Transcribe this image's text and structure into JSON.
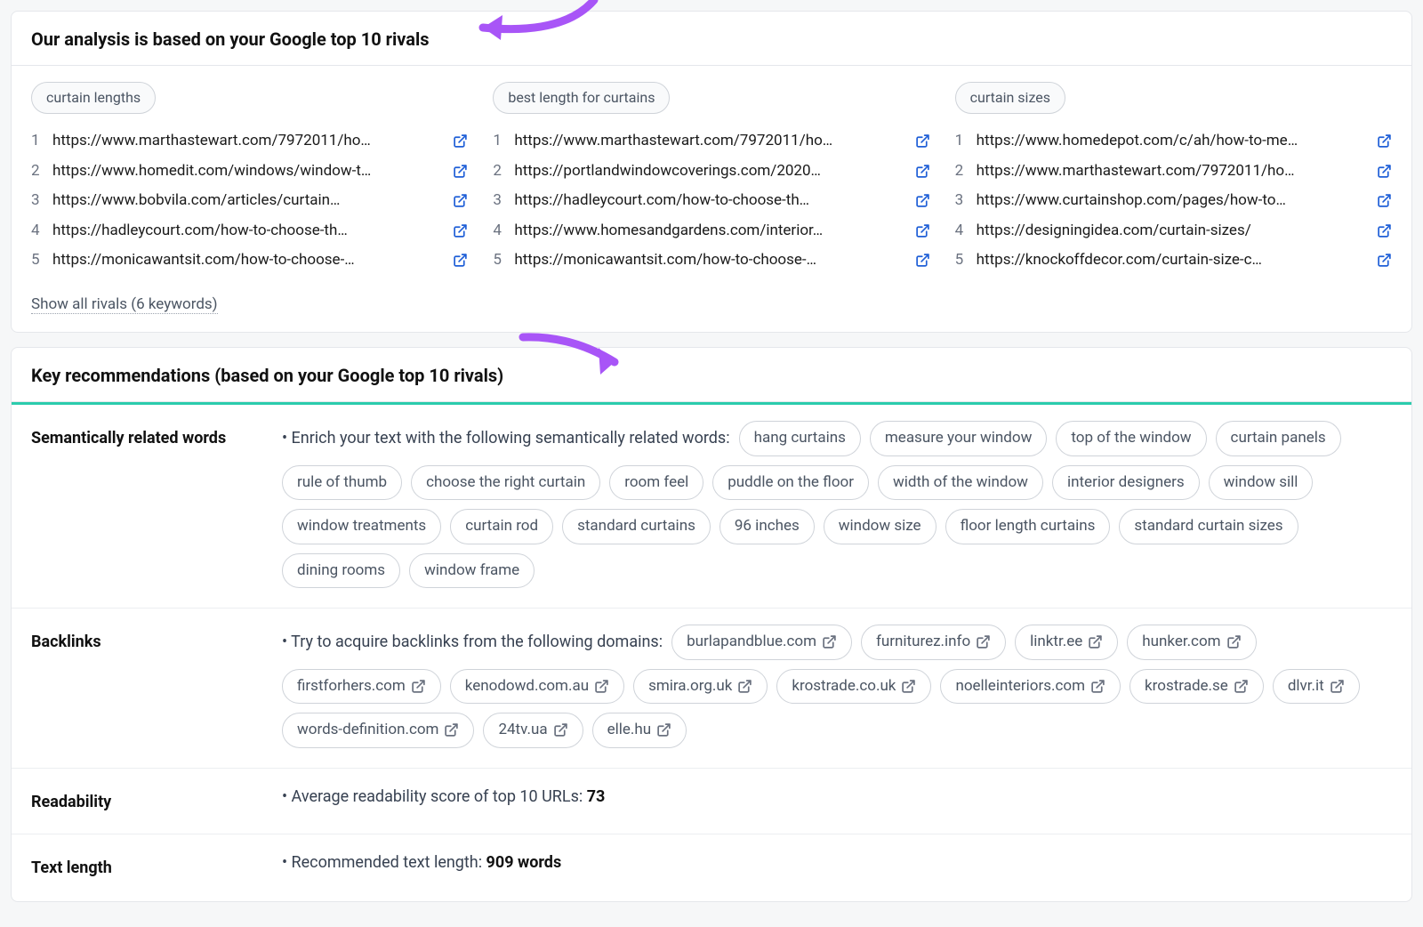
{
  "rivals": {
    "title": "Our analysis is based on your Google top 10 rivals",
    "keywords": [
      {
        "label": "curtain lengths",
        "urls": [
          "https://www.marthastewart.com/7972011/ho…",
          "https://www.homedit.com/windows/window-t…",
          "https://www.bobvila.com/articles/curtain…",
          "https://hadleycourt.com/how-to-choose-th…",
          "https://monicawantsit.com/how-to-choose-…"
        ]
      },
      {
        "label": "best length for curtains",
        "urls": [
          "https://www.marthastewart.com/7972011/ho…",
          "https://portlandwindowcoverings.com/2020…",
          "https://hadleycourt.com/how-to-choose-th…",
          "https://www.homesandgardens.com/interior…",
          "https://monicawantsit.com/how-to-choose-…"
        ]
      },
      {
        "label": "curtain sizes",
        "urls": [
          "https://www.homedepot.com/c/ah/how-to-me…",
          "https://www.marthastewart.com/7972011/ho…",
          "https://www.curtainshop.com/pages/how-to…",
          "https://designingidea.com/curtain-sizes/",
          "https://knockoffdecor.com/curtain-size-c…"
        ]
      }
    ],
    "show_all": "Show all rivals (6 keywords)"
  },
  "recs": {
    "title": "Key recommendations (based on your Google top 10 rivals)",
    "semantic": {
      "label": "Semantically related words",
      "intro": "• Enrich your text with the following semantically related words:",
      "words": [
        "hang curtains",
        "measure your window",
        "top of the window",
        "curtain panels",
        "rule of thumb",
        "choose the right curtain",
        "room feel",
        "puddle on the floor",
        "width of the window",
        "interior designers",
        "window sill",
        "window treatments",
        "curtain rod",
        "standard curtains",
        "96 inches",
        "window size",
        "floor length curtains",
        "standard curtain sizes",
        "dining rooms",
        "window frame"
      ]
    },
    "backlinks": {
      "label": "Backlinks",
      "intro": "• Try to acquire backlinks from the following domains:",
      "domains": [
        "burlapandblue.com",
        "furniturez.info",
        "linktr.ee",
        "hunker.com",
        "firstforhers.com",
        "kenodowd.com.au",
        "smira.org.uk",
        "krostrade.co.uk",
        "noelleinteriors.com",
        "krostrade.se",
        "dlvr.it",
        "words-definition.com",
        "24tv.ua",
        "elle.hu"
      ]
    },
    "readability": {
      "label": "Readability",
      "text_pre": "• Average readability score of top 10 URLs: ",
      "value": "73"
    },
    "textlength": {
      "label": "Text length",
      "text_pre": "• Recommended text length: ",
      "value": "909 words"
    }
  }
}
